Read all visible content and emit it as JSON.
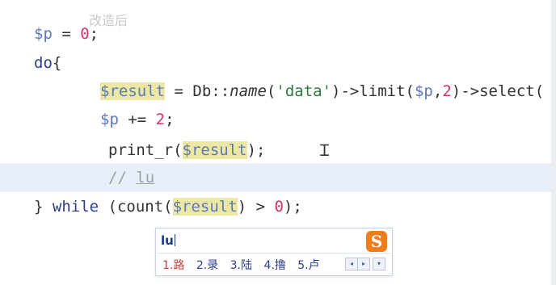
{
  "editor": {
    "top_faded_text": "改造后",
    "line1": {
      "var": "$p",
      "rest_a": " = ",
      "num": "0",
      "rest_b": ";"
    },
    "line2": {
      "kw": "do",
      "brace": "{"
    },
    "line3": {
      "var": "$result",
      "a": " = Db::",
      "fn": "name",
      "b": "(",
      "str": "'data'",
      "c": ")->limit(",
      "var2": "$p",
      "d": ",",
      "num": "2",
      "e": ")->select("
    },
    "line4": {
      "var": "$p",
      "a": " += ",
      "num": "2",
      "b": ";"
    },
    "line5": {
      "a": "print_r(",
      "var": "$result",
      "b": ");"
    },
    "line6": {
      "comment": "// ",
      "typed": "lu"
    },
    "line7": {
      "a": "} ",
      "kw": "while",
      "b": " (count(",
      "var": "$result",
      "c": ") > ",
      "num": "0",
      "d": ");"
    }
  },
  "ime": {
    "input": "lu",
    "logo": "S",
    "candidates": [
      "1.路",
      "2.录",
      "3.陆",
      "4.撸",
      "5.卢"
    ],
    "nav": {
      "prev": "◂",
      "next": "▸",
      "expand": "▾"
    },
    "colors": {
      "logo": "#f07c1c",
      "first_candidate": "#d23b3b",
      "candidates": "#2b3f8f"
    }
  },
  "colors": {
    "variable": "#5b7ab8",
    "highlight": "#ece8a4",
    "keyword": "#2b3f8f",
    "number": "#d6336c",
    "string": "#2f7a3c",
    "current_line": "#e8eef7"
  }
}
